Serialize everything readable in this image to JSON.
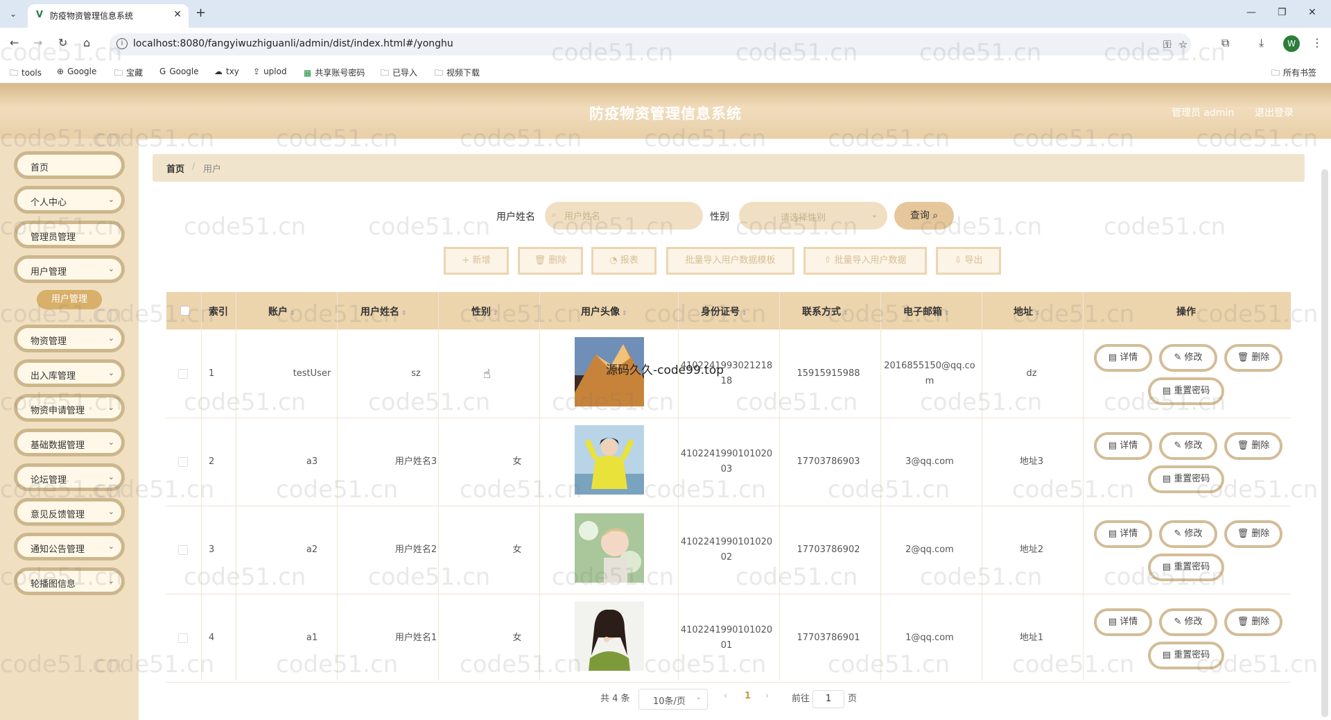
{
  "browser": {
    "tab_title": "防疫物资管理信息系统",
    "url": "localhost:8080/fangyiwuzhiguanli/admin/dist/index.html#/yonghu",
    "profile_initial": "W",
    "bookmarks": [
      "tools",
      "Google",
      "宝藏",
      "Google",
      "txy",
      "uplod",
      "共享账号密码",
      "已导入",
      "视频下载"
    ],
    "all_bookmarks": "所有书签"
  },
  "header": {
    "title": "防疫物资管理信息系统",
    "user": "管理员 admin",
    "logout": "退出登录"
  },
  "sidebar": {
    "items": [
      {
        "label": "首页",
        "has_children": false
      },
      {
        "label": "个人中心",
        "has_children": true
      },
      {
        "label": "管理员管理",
        "has_children": false
      },
      {
        "label": "用户管理",
        "has_children": true
      },
      {
        "label": "物资管理",
        "has_children": true
      },
      {
        "label": "出入库管理",
        "has_children": true
      },
      {
        "label": "物资申请管理",
        "has_children": true
      },
      {
        "label": "基础数据管理",
        "has_children": true
      },
      {
        "label": "论坛管理",
        "has_children": true
      },
      {
        "label": "意见反馈管理",
        "has_children": true
      },
      {
        "label": "通知公告管理",
        "has_children": true
      },
      {
        "label": "轮播图信息",
        "has_children": true
      }
    ],
    "active_sub": "用户管理"
  },
  "breadcrumb": {
    "home": "首页",
    "sep": "/",
    "current": "用户"
  },
  "search": {
    "name_label": "用户姓名",
    "name_placeholder": "用户姓名",
    "gender_label": "性别",
    "gender_placeholder": "请选择性别",
    "query_label": "查询"
  },
  "actions": {
    "add": "+ 新增",
    "delete": "删除",
    "report": "报表",
    "template": "批量导入用户数据模板",
    "import": "批量导入用户数据",
    "export": "导出"
  },
  "table": {
    "columns": [
      "索引",
      "账户",
      "用户姓名",
      "性别",
      "用户头像",
      "身份证号",
      "联系方式",
      "电子邮箱",
      "地址",
      "操作"
    ],
    "rows": [
      {
        "index": "1",
        "account": "testUser",
        "name": "sz",
        "gender": "",
        "id_card": "4102241993021218\n18",
        "phone": "15915915988",
        "email": "2016855150@qq.co\nm",
        "address": "dz",
        "avatar": "mountain"
      },
      {
        "index": "2",
        "account": "a3",
        "name": "用户姓名3",
        "gender": "女",
        "id_card": "4102241990101020\n03",
        "phone": "17703786903",
        "email": "3@qq.com",
        "address": "地址3",
        "avatar": "girl-yellow"
      },
      {
        "index": "3",
        "account": "a2",
        "name": "用户姓名2",
        "gender": "女",
        "id_card": "4102241990101020\n02",
        "phone": "17703786902",
        "email": "2@qq.com",
        "address": "地址2",
        "avatar": "boy-flowers"
      },
      {
        "index": "4",
        "account": "a1",
        "name": "用户姓名1",
        "gender": "女",
        "id_card": "4102241990101020\n01",
        "phone": "17703786901",
        "email": "1@qq.com",
        "address": "地址1",
        "avatar": "girl-green"
      }
    ],
    "row_actions": {
      "detail": "详情",
      "edit": "修改",
      "delete": "删除",
      "reset": "重置密码"
    }
  },
  "pagination": {
    "total": "共 4 条",
    "page_size": "10条/页",
    "current": "1",
    "goto": "前往",
    "page_suffix": "页",
    "jump_value": "1"
  },
  "overlay_text": "源码久久-code99.top",
  "watermark": "code51.cn",
  "colors": {
    "accent": "#d8b06a",
    "header_bg": "#e8cfa8",
    "sidebar_bg": "#f1dfc1",
    "table_head": "#ecd4ad"
  }
}
